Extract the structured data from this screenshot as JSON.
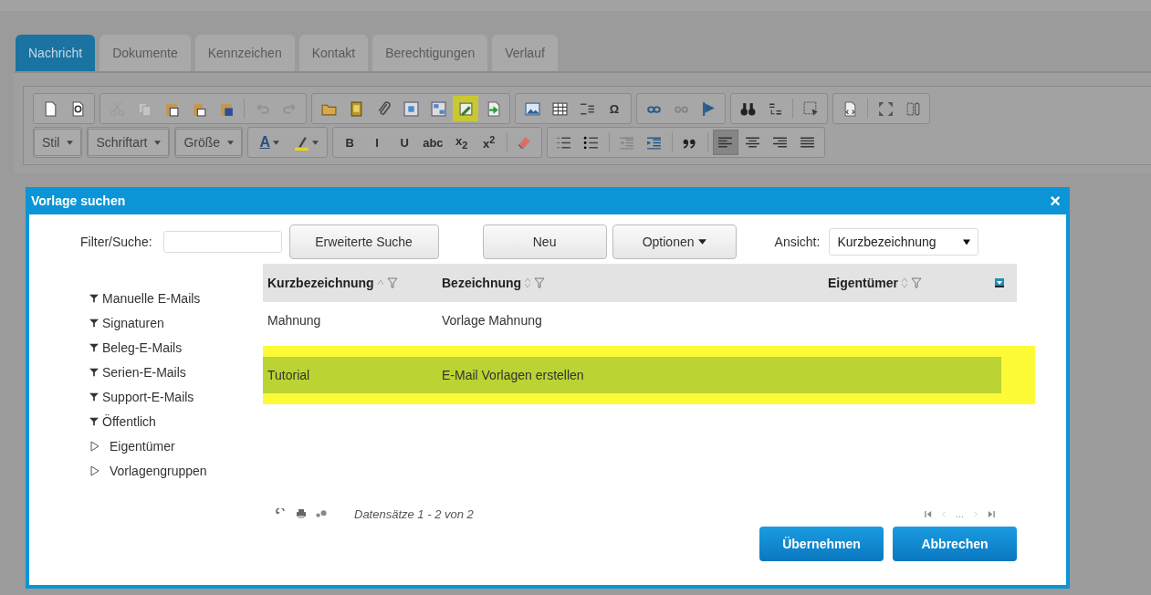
{
  "tabs": [
    {
      "label": "Nachricht",
      "selected": true
    },
    {
      "label": "Dokumente",
      "selected": false
    },
    {
      "label": "Kennzeichen",
      "selected": false
    },
    {
      "label": "Kontakt",
      "selected": false
    },
    {
      "label": "Berechtigungen",
      "selected": false
    },
    {
      "label": "Verlauf",
      "selected": false
    }
  ],
  "toolbar": {
    "rows": [
      {
        "groups": [
          {
            "items": [
              {
                "kind": "icon",
                "disabled": false,
                "highlighted": false
              },
              {
                "kind": "icon",
                "disabled": false,
                "highlighted": false
              }
            ]
          },
          {
            "items": [
              {
                "kind": "icon",
                "disabled": true,
                "highlighted": false
              },
              {
                "kind": "icon",
                "disabled": true,
                "highlighted": false
              },
              {
                "kind": "icon",
                "disabled": false,
                "highlighted": false
              },
              {
                "kind": "icon",
                "disabled": false,
                "highlighted": false
              },
              {
                "kind": "icon",
                "disabled": false,
                "highlighted": false
              },
              {
                "kind": "separator"
              },
              {
                "kind": "icon",
                "disabled": true,
                "highlighted": false
              },
              {
                "kind": "icon",
                "disabled": true,
                "highlighted": false
              }
            ]
          },
          {
            "items": [
              {
                "kind": "icon",
                "disabled": false,
                "highlighted": false
              },
              {
                "kind": "icon",
                "disabled": false,
                "highlighted": false
              },
              {
                "kind": "icon",
                "disabled": false,
                "highlighted": false
              },
              {
                "kind": "icon",
                "disabled": false,
                "highlighted": false
              },
              {
                "kind": "icon",
                "disabled": false,
                "highlighted": false
              },
              {
                "kind": "icon",
                "disabled": false,
                "highlighted": true
              },
              {
                "kind": "icon",
                "disabled": false,
                "highlighted": false
              }
            ]
          },
          {
            "items": [
              {
                "kind": "icon",
                "disabled": false,
                "highlighted": false
              },
              {
                "kind": "icon",
                "disabled": false,
                "highlighted": false
              },
              {
                "kind": "icon",
                "disabled": false,
                "highlighted": false
              },
              {
                "kind": "glyph",
                "label": "Ω",
                "disabled": false
              }
            ]
          },
          {
            "items": [
              {
                "kind": "icon",
                "disabled": false,
                "highlighted": false
              },
              {
                "kind": "icon",
                "disabled": true,
                "highlighted": false
              },
              {
                "kind": "icon",
                "disabled": false,
                "highlighted": false
              }
            ]
          },
          {
            "items": [
              {
                "kind": "icon",
                "disabled": false,
                "highlighted": false
              },
              {
                "kind": "icon",
                "disabled": false,
                "highlighted": false
              },
              {
                "kind": "separator"
              },
              {
                "kind": "icon",
                "disabled": false,
                "highlighted": false
              }
            ]
          },
          {
            "items": [
              {
                "kind": "icon",
                "disabled": false,
                "highlighted": false
              },
              {
                "kind": "separator"
              },
              {
                "kind": "icon",
                "disabled": false,
                "highlighted": false
              },
              {
                "kind": "icon",
                "disabled": false,
                "highlighted": false
              }
            ]
          }
        ]
      },
      {
        "groups": [
          {
            "items": [
              {
                "kind": "dropdown",
                "label": "Stil"
              }
            ]
          },
          {
            "items": [
              {
                "kind": "dropdown",
                "label": "Schriftart"
              }
            ]
          },
          {
            "items": [
              {
                "kind": "dropdown",
                "label": "Größe"
              }
            ]
          },
          {
            "items": [
              {
                "kind": "color",
                "label": "A"
              },
              {
                "kind": "icon-dropdown",
                "disabled": false,
                "highlighted": false
              }
            ]
          },
          {
            "items": [
              {
                "kind": "glyph",
                "label": "B",
                "disabled": false
              },
              {
                "kind": "glyph",
                "label": "I",
                "disabled": false
              },
              {
                "kind": "glyph",
                "label": "U",
                "disabled": false
              },
              {
                "kind": "glyph",
                "label": "abc",
                "disabled": false
              },
              {
                "kind": "glyph",
                "label": "x$_{2}$",
                "disabled": false
              },
              {
                "kind": "glyph",
                "label": "x$^{2}$",
                "disabled": false
              },
              {
                "kind": "separator"
              },
              {
                "kind": "icon",
                "disabled": false,
                "highlighted": false
              }
            ]
          },
          {
            "items": [
              {
                "kind": "icon",
                "disabled": false,
                "highlighted": false,
                "pressed": false
              },
              {
                "kind": "icon",
                "disabled": false,
                "highlighted": false,
                "pressed": false
              },
              {
                "kind": "separator"
              },
              {
                "kind": "icon",
                "disabled": true,
                "highlighted": false,
                "pressed": false
              },
              {
                "kind": "icon",
                "disabled": false,
                "highlighted": false,
                "pressed": false
              },
              {
                "kind": "separator"
              },
              {
                "kind": "icon",
                "disabled": false,
                "highlighted": false,
                "pressed": false
              },
              {
                "kind": "separator"
              },
              {
                "kind": "icon",
                "disabled": false,
                "highlighted": false,
                "pressed": true
              },
              {
                "kind": "icon",
                "disabled": false,
                "highlighted": false,
                "pressed": false
              },
              {
                "kind": "icon",
                "disabled": false,
                "highlighted": false,
                "pressed": false
              },
              {
                "kind": "icon",
                "disabled": false,
                "highlighted": false,
                "pressed": false
              }
            ]
          }
        ]
      }
    ]
  },
  "dialog": {
    "title": "Vorlage suchen",
    "close": "×",
    "filter": {
      "label": "Filter/Suche:",
      "button": "Erweiterte Suche"
    },
    "buttons": [
      {
        "label": "Neu",
        "kind": "plain"
      },
      {
        "label": "Optionen",
        "kind": "menu"
      }
    ],
    "view": {
      "label": "Ansicht:",
      "value": "Kurzbezeichnung"
    },
    "sidebar": [
      {
        "kind": "filter",
        "label": "Manuelle E-Mails"
      },
      {
        "kind": "filter",
        "label": "Signaturen"
      },
      {
        "kind": "filter",
        "label": "Beleg-E-Mails"
      },
      {
        "kind": "filter",
        "label": "Serien-E-Mails"
      },
      {
        "kind": "filter",
        "label": "Support-E-Mails"
      },
      {
        "kind": "filter",
        "label": "Öffentlich"
      },
      {
        "kind": "tree",
        "label": "Eigentümer",
        "expanded": false
      },
      {
        "kind": "tree",
        "label": "Vorlagengruppen",
        "expanded": false
      }
    ],
    "table": {
      "columns": [
        {
          "kind": "text",
          "label": "Kurzbezeichnung",
          "sorted": true
        },
        {
          "kind": "text",
          "label": "Bezeichnung",
          "sorted": false
        },
        {
          "kind": "text",
          "label": "Eigentümer",
          "sorted": false
        },
        {
          "kind": "icon"
        }
      ],
      "rows": [
        {
          "cells": [
            "Mahnung",
            "Vorlage Mahnung"
          ],
          "selected": false,
          "highlighted": false
        },
        {
          "cells": [
            "Tutorial",
            "E-Mail Vorlagen erstellen"
          ],
          "selected": true,
          "highlighted": true
        }
      ]
    },
    "records": "Datensätze 1 - 2 von 2",
    "pager": {
      "ellipsis": "..."
    },
    "actions": [
      "Übernehmen",
      "Abbrechen"
    ]
  }
}
